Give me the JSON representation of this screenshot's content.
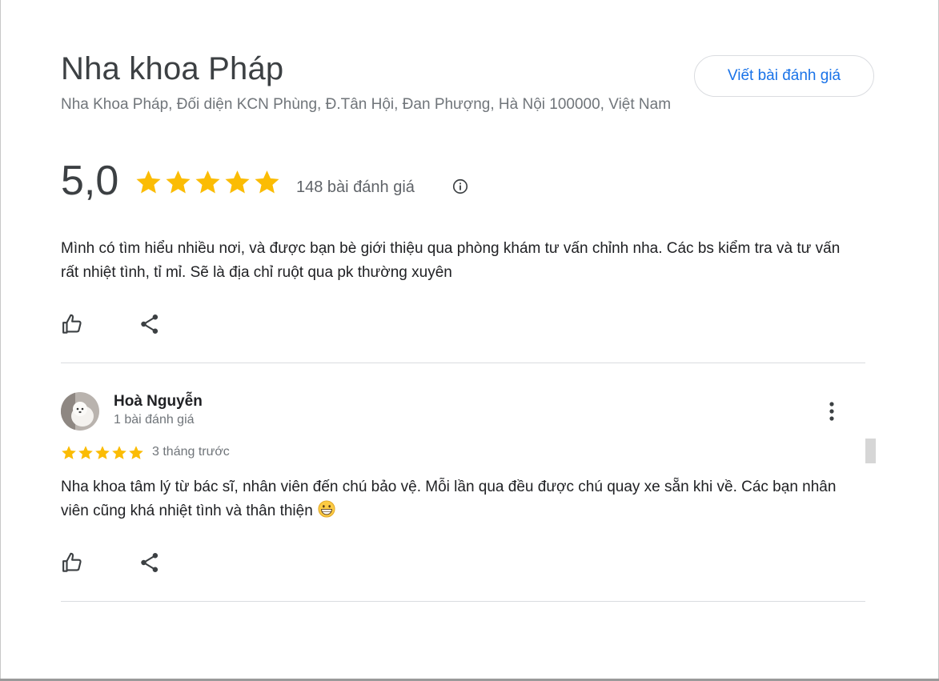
{
  "header": {
    "title": "Nha khoa Pháp",
    "address": "Nha Khoa Pháp, Đối diện KCN Phùng, Đ.Tân Hội, Đan Phượng, Hà Nội 100000, Việt Nam",
    "write_review_label": "Viết bài đánh giá"
  },
  "summary": {
    "rating": "5,0",
    "stars": 5,
    "review_count": "148 bài đánh giá",
    "star_color": "#fbbc04"
  },
  "reviews": [
    {
      "text": "Mình có tìm hiểu nhiều nơi, và được bạn bè giới thiệu qua phòng khám tư vấn chỉnh nha. Các bs kiểm tra và tư vấn rất nhiệt tình, tỉ mỉ. Sẽ là địa chỉ ruột qua pk thường xuyên"
    },
    {
      "author": "Hoà Nguyễn",
      "author_review_count": "1 bài đánh giá",
      "stars": 5,
      "time": "3 tháng trước",
      "text": "Nha khoa tâm lý từ bác sĩ, nhân viên đến chú bảo vệ. Mỗi lần qua đều được chú quay xe sẵn khi về. Các bạn nhân viên cũng khá nhiệt tình và thân thiện",
      "emoji": "grinning-face-emoji"
    }
  ],
  "icons": {
    "like": "thumbs-up-icon",
    "share": "share-icon",
    "info": "info-icon",
    "more": "more-vertical-icon"
  },
  "colors": {
    "accent": "#1a73e8",
    "star": "#fbbc04",
    "divider": "#dadce0"
  }
}
